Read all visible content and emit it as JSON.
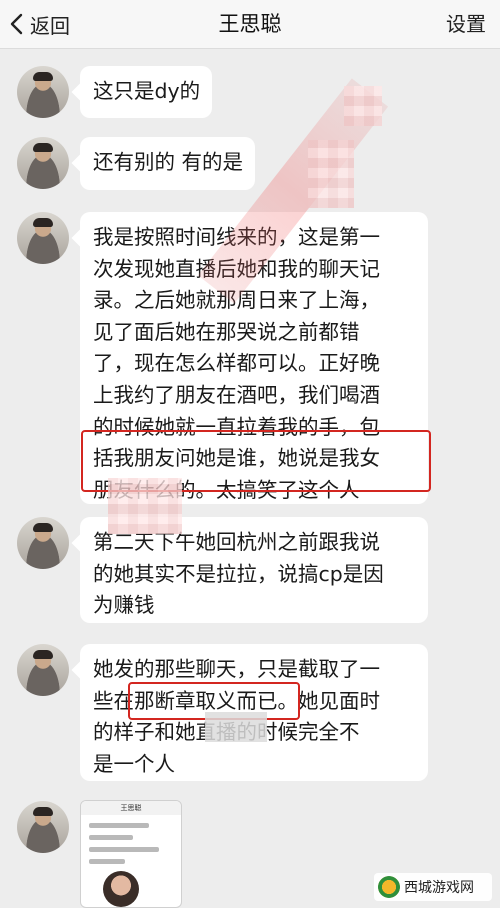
{
  "nav": {
    "back_label": "返回",
    "title": "王思聪",
    "settings_label": "设置"
  },
  "messages": [
    {
      "lines": [
        "这只是dy的"
      ]
    },
    {
      "lines": [
        "还有别的 有的是"
      ]
    },
    {
      "lines": [
        "我是按照时间线来的，这是第一",
        "次发现她直播后她和我的聊天记",
        "录。之后她就那周日来了上海，",
        "见了面后她在那哭说之前都错",
        "了，现在怎么样都可以。正好晚",
        "上我约了朋友在酒吧，我们喝酒",
        "的时候她就一直拉着我的手，包",
        "括我朋友问她是谁，她说是我女",
        "朋友什么的。太搞笑了这个人"
      ]
    },
    {
      "lines": [
        "第二天下午她回杭州之前跟我说",
        "的她其实不是拉拉，说搞cp是因",
        "为赚钱"
      ]
    },
    {
      "lines": [
        "她发的那些聊天，只是截取了一",
        "些在那断章取义而已。她见面时",
        "的样子和她直播的时候完全不",
        "是一个人"
      ]
    }
  ],
  "thumbnail": {
    "title": "王思聪"
  },
  "watermark": {
    "site_name": "西城游戏网"
  }
}
